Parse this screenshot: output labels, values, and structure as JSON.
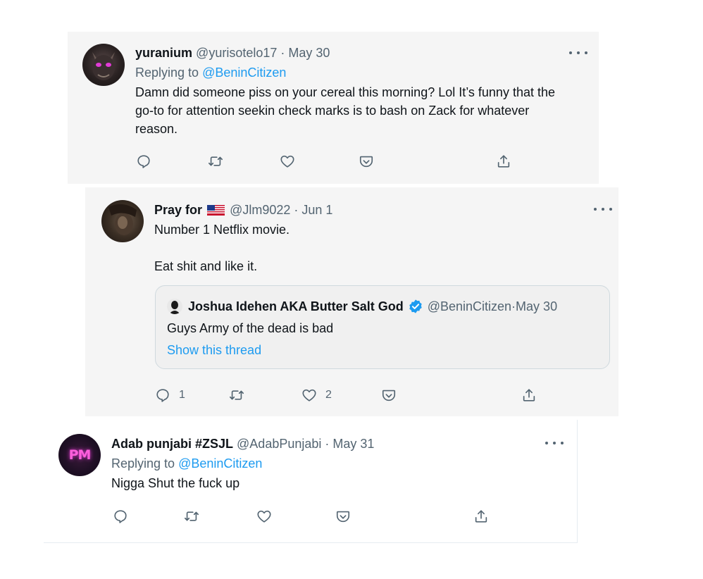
{
  "tweets": [
    {
      "display_name": "yuranium",
      "handle": "@yurisotelo17",
      "date": "May 30",
      "replying_prefix": "Replying to ",
      "replying_to": "@BeninCitizen",
      "text": "Damn did someone piss on your cereal this morning? Lol It’s funny that the go-to for attention seekin check marks is to bash on Zack for whatever reason."
    },
    {
      "display_name": "Pray for",
      "flag": "us-flag",
      "handle": "@Jlm9022",
      "date": "Jun 1",
      "text_line1": "Number 1 Netflix movie.",
      "text_line2": "Eat shit and like it.",
      "quote": {
        "display_name": "Joshua Idehen AKA Butter Salt God",
        "handle": "@BeninCitizen",
        "date": "May 30",
        "text": "Guys Army of the dead is bad",
        "show_thread": "Show this thread"
      },
      "reply_count": "1",
      "like_count": "2"
    },
    {
      "display_name": "Adab punjabi #ZSJL",
      "handle": "@AdabPunjabi",
      "date": "May 31",
      "replying_prefix": "Replying to ",
      "replying_to": "@BeninCitizen",
      "text": "Nigga Shut the fuck up",
      "avatar_text": "PM"
    }
  ],
  "separator": " · ",
  "icons": [
    "reply-icon",
    "retweet-icon",
    "like-icon",
    "pocket-icon",
    "share-icon",
    "more-icon",
    "verified-icon"
  ],
  "colors": {
    "link": "#1d9bf0",
    "muted": "#536471",
    "text": "#0f1419",
    "neon_pink": "#e23bd6"
  }
}
